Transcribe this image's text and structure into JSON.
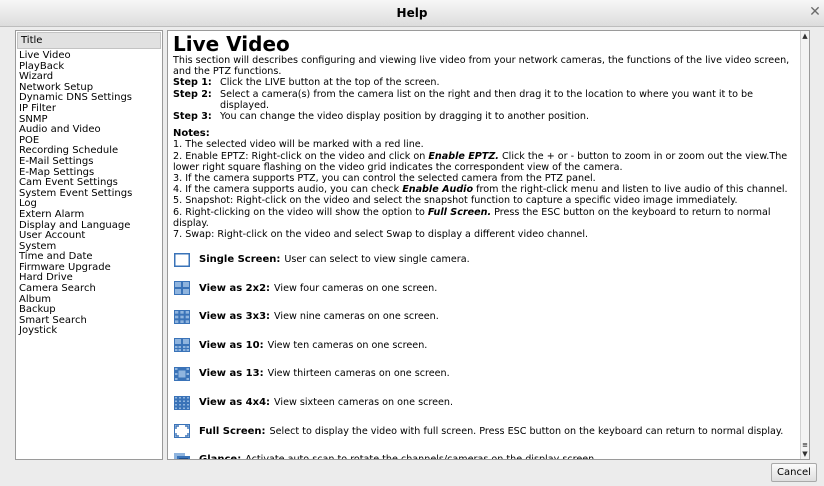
{
  "window": {
    "title": "Help"
  },
  "sidebar": {
    "title": "Title",
    "items": [
      "Live Video",
      "PlayBack",
      "Wizard",
      "Network Setup",
      "Dynamic DNS Settings",
      "IP Filter",
      "SNMP",
      "Audio and Video",
      "POE",
      "Recording Schedule",
      "E-Mail Settings",
      "E-Map Settings",
      "Cam Event Settings",
      "System Event Settings",
      "Log",
      "Extern Alarm",
      "Display and Language",
      "User Account",
      "System",
      "Time and Date",
      "Firmware Upgrade",
      "Hard Drive",
      "Camera Search",
      "Album",
      "Backup",
      "Smart Search",
      "Joystick"
    ]
  },
  "content": {
    "heading": "Live Video",
    "intro": "This section will describes configuring and viewing live video from your network cameras, the functions of the live video screen, and the PTZ functions.",
    "steps": [
      {
        "label": "Step 1:",
        "text": "Click the LIVE button at the top of the screen."
      },
      {
        "label": "Step 2:",
        "text": "Select a camera(s) from the camera list on the right and then drag it to the location to where you want it to be displayed."
      },
      {
        "label": "Step 3:",
        "text": "You can change the video display position by dragging it to another position."
      }
    ],
    "notes_title": "Notes:",
    "notes": [
      {
        "pre": "1. The selected video will be marked with a red line.",
        "em": "",
        "post": ""
      },
      {
        "pre": "2. Enable EPTZ: Right-click on the video and click on ",
        "em": "Enable EPTZ.",
        "post": " Click the + or - button to zoom in or zoom out the view.The lower right square flashing on the video grid indicates the correspondent view of the camera."
      },
      {
        "pre": "3. If the camera supports PTZ, you can control the selected camera from the PTZ panel.",
        "em": "",
        "post": ""
      },
      {
        "pre": "4. If the camera supports audio, you can check ",
        "em": "Enable Audio",
        "post": " from the right-click menu and listen to live audio of this channel."
      },
      {
        "pre": "5. Snapshot: Right-click on the video and select the snapshot function to capture a specific video image immediately.",
        "em": "",
        "post": ""
      },
      {
        "pre": "6. Right-clicking on the video will show the option to ",
        "em": "Full Screen.",
        "post": " Press the ESC button on the keyboard to return to normal display."
      },
      {
        "pre": "7. Swap: Right-click on the video and select Swap to display a different video channel.",
        "em": "",
        "post": ""
      }
    ],
    "views": [
      {
        "icon": "single-screen-icon",
        "name": "Single Screen:",
        "desc": "User can select to view single camera."
      },
      {
        "icon": "grid-2x2-icon",
        "name": "View as 2x2:",
        "desc": "View four cameras on one screen."
      },
      {
        "icon": "grid-3x3-icon",
        "name": "View as 3x3:",
        "desc": "View nine cameras on one screen."
      },
      {
        "icon": "grid-10-icon",
        "name": "View as 10:",
        "desc": "View ten cameras on one screen."
      },
      {
        "icon": "grid-13-icon",
        "name": "View as 13:",
        "desc": "View thirteen cameras on one screen."
      },
      {
        "icon": "grid-4x4-icon",
        "name": "View as 4x4:",
        "desc": "View sixteen cameras on one screen."
      },
      {
        "icon": "full-screen-icon",
        "name": "Full Screen:",
        "desc": "Select to display the video with full screen. Press ESC button on the keyboard can return to normal display."
      },
      {
        "icon": "glance-icon",
        "name": "Glance:",
        "desc": "Activate auto scan to rotate the channels/cameras on the display screen."
      }
    ]
  },
  "footer": {
    "cancel_label": "Cancel"
  },
  "colors": {
    "icon_blue": "#3a73b8",
    "icon_light": "#8fb4de"
  }
}
